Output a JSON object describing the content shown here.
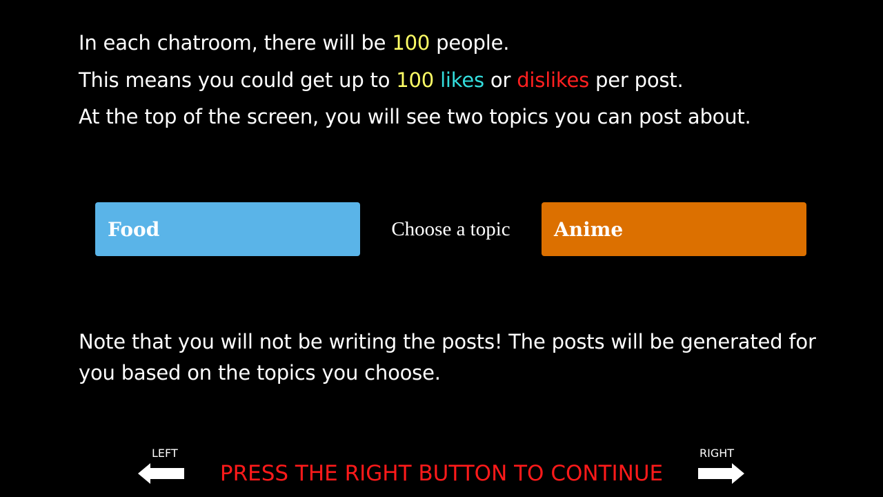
{
  "colors": {
    "background": "#000000",
    "text": "#ffffff",
    "highlight_number": "#ffff66",
    "likes": "#33dddd",
    "dislikes": "#ff2020",
    "continue": "#ff1a1a",
    "topic_left_bg": "#5ab4e8",
    "topic_right_bg": "#dc7000"
  },
  "instructions": {
    "line1": {
      "prefix": "In each chatroom, there will be ",
      "number": "100",
      "suffix": " people."
    },
    "line2": {
      "prefix": "This means you could get up to ",
      "number": "100",
      "likes": "likes",
      "or": " or ",
      "dislikes": "dislikes",
      "suffix": " per post."
    },
    "line3": "At the top of the screen, you will see two topics you can post about."
  },
  "topic_bar": {
    "left_topic": "Food",
    "prompt": "Choose a topic",
    "right_topic": "Anime"
  },
  "note": "Note that you will not be writing the posts! The posts will be generated for you based on the topics you choose.",
  "navigation": {
    "left_label": "LEFT",
    "right_label": "RIGHT",
    "left_icon": "left-arrow-icon",
    "right_icon": "right-arrow-icon",
    "continue_text": "PRESS THE RIGHT BUTTON TO CONTINUE"
  }
}
